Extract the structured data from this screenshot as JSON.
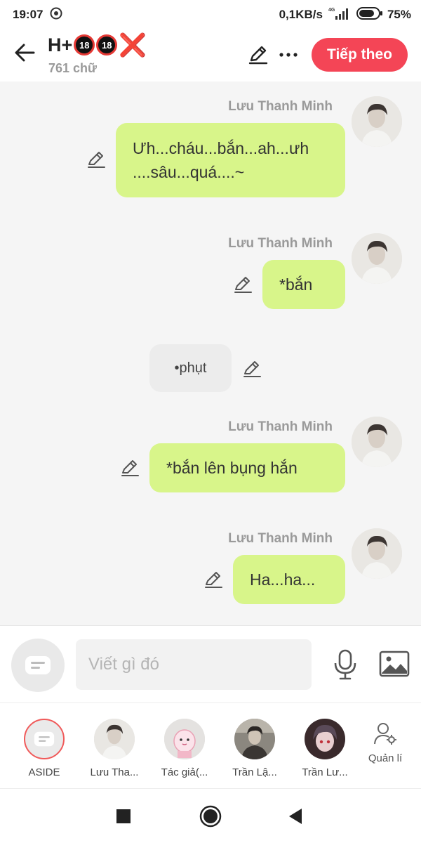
{
  "status_bar": {
    "time": "19:07",
    "network_speed": "0,1KB/s",
    "signal_label": "4G",
    "battery": "75%"
  },
  "header": {
    "title": "H+",
    "title_badges": [
      "18",
      "18"
    ],
    "title_x": "❌",
    "word_count": "761 chữ",
    "next_label": "Tiếp theo"
  },
  "messages": [
    {
      "type": "character",
      "sender": "Lưu Thanh Minh",
      "lines": [
        "Ưh...cháu...bắn...ah...ưh",
        "....sâu...quá....~"
      ]
    },
    {
      "type": "character",
      "sender": "Lưu Thanh Minh",
      "text": "*bắn"
    },
    {
      "type": "system",
      "text": "•phụt"
    },
    {
      "type": "character",
      "sender": "Lưu Thanh Minh",
      "text": "*bắn lên bụng hắn"
    },
    {
      "type": "character",
      "sender": "Lưu Thanh Minh",
      "text": "Ha...ha..."
    }
  ],
  "composer": {
    "placeholder": "Viết gì đó"
  },
  "characters": [
    {
      "label": "ASIDE"
    },
    {
      "label": "Lưu Tha..."
    },
    {
      "label": "Tác giả(..."
    },
    {
      "label": "Trần Lậ..."
    },
    {
      "label": "Trần Lư..."
    }
  ],
  "manage_label": "Quản lí",
  "colors": {
    "accent": "#f44556",
    "bubble": "#d8f58a",
    "system_bubble": "#ececec",
    "background": "#f5f5f5"
  }
}
